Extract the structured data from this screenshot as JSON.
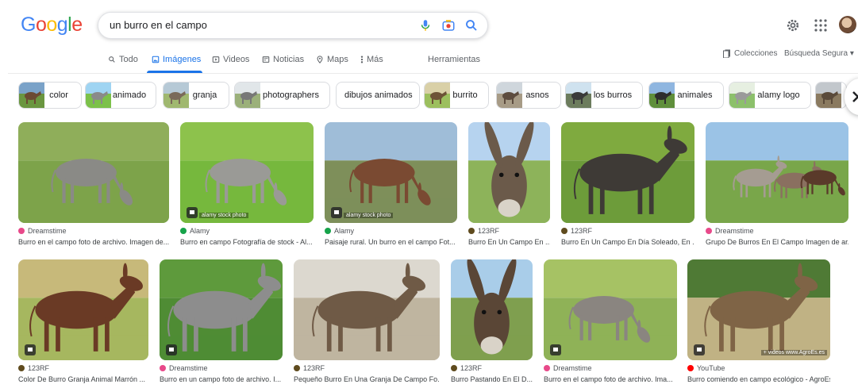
{
  "search": {
    "query": "un burro en el campo"
  },
  "logo": {
    "letters": [
      "G",
      "o",
      "o",
      "g",
      "l",
      "e"
    ],
    "colors": [
      "#4285f4",
      "#ea4335",
      "#fbbc05",
      "#4285f4",
      "#34a853",
      "#ea4335"
    ]
  },
  "tabs": [
    {
      "label": "Todo",
      "icon": "search-icon"
    },
    {
      "label": "Imágenes",
      "icon": "image-icon",
      "active": true
    },
    {
      "label": "Videos",
      "icon": "video-icon"
    },
    {
      "label": "Noticias",
      "icon": "news-icon"
    },
    {
      "label": "Maps",
      "icon": "map-pin-icon"
    },
    {
      "label": "Más",
      "icon": "more-vert-icon"
    }
  ],
  "tools_label": "Herramientas",
  "collections_label": "Colecciones",
  "safesearch_label": "Búsqueda Segura",
  "chips": [
    {
      "label": "color"
    },
    {
      "label": "animado"
    },
    {
      "label": "granja"
    },
    {
      "label": "photographers"
    },
    {
      "label": "dibujos animados"
    },
    {
      "label": "burrito"
    },
    {
      "label": "asnos"
    },
    {
      "label": "los burros"
    },
    {
      "label": "animales"
    },
    {
      "label": "alamy logo"
    },
    {
      "label": ""
    }
  ],
  "results": [
    {
      "source": "Dreamstime",
      "caption": "Burro en el campo foto de archivo. Imagen de...",
      "favicon": "#e8498a"
    },
    {
      "source": "Alamy",
      "caption": "Burro en campo Fotografía de stock - Al...",
      "favicon": "#16a34a",
      "watermark": "alamy stock photo"
    },
    {
      "source": "Alamy",
      "caption": "Paisaje rural. Un burro en el campo Fot...",
      "favicon": "#16a34a",
      "watermark": "alamy stock photo"
    },
    {
      "source": "123RF",
      "caption": "Burro En Un Campo En ...",
      "favicon": "#5f4b1e"
    },
    {
      "source": "123RF",
      "caption": "Burro En Un Campo En Día Soleado, En ...",
      "favicon": "#5f4b1e"
    },
    {
      "source": "Dreamstime",
      "caption": "Grupo De Burros En El Campo Imagen de ar...",
      "favicon": "#e8498a"
    },
    {
      "source": "123RF",
      "caption": "Color De Burro Granja Animal Marrón ...",
      "favicon": "#5f4b1e"
    },
    {
      "source": "Dreamstime",
      "caption": "Burro en un campo foto de archivo. I...",
      "favicon": "#e8498a"
    },
    {
      "source": "123RF",
      "caption": "Pequeño Burro En Una Granja De Campo Fo...",
      "favicon": "#5f4b1e"
    },
    {
      "source": "123RF",
      "caption": "Burro Pastando En El D...",
      "favicon": "#5f4b1e"
    },
    {
      "source": "Dreamstime",
      "caption": "Burro en el campo foto de archivo. Ima...",
      "favicon": "#e8498a"
    },
    {
      "source": "YouTube",
      "caption": "Burro comiendo en campo ecológico - AgroEs.es -...",
      "favicon": "#ff0000",
      "watermark": "+ videos www.AgroEs.es"
    }
  ]
}
